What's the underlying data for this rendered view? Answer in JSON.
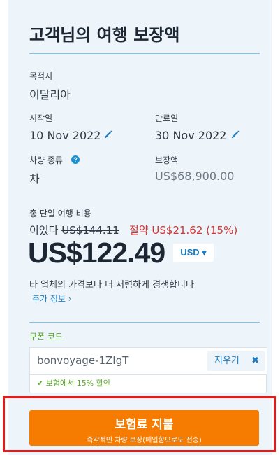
{
  "title": "고객님의 여행 보장액",
  "destination": {
    "label": "목적지",
    "value": "이탈리아"
  },
  "start": {
    "label": "시작일",
    "value": "10 Nov 2022"
  },
  "end": {
    "label": "만료일",
    "value": "30 Nov 2022"
  },
  "vehicle": {
    "label": "차량 종류",
    "value": "차",
    "help": "?"
  },
  "coverage": {
    "label": "보장액",
    "value": "US$68,900.00"
  },
  "pricing": {
    "label": "총 단일 여행 비용",
    "was_prefix": "이었다",
    "old_price": "US$144.11",
    "savings": "절약 US$21.62 (15%)",
    "price": "US$122.49",
    "currency": "USD ▾",
    "compare_text": "타 업체의 가격보다 더 저렴하게 경쟁합니다",
    "more_info": "추가 정보 ›"
  },
  "coupon": {
    "label": "쿠폰 코드",
    "value": "bonvoyage-1ZIgT",
    "clear_label": "지우기",
    "clear_icon": "✖",
    "success_text": "✔ 보험에서 15% 할인"
  },
  "pay_button": {
    "label": "보험료 지불",
    "sublabel": "즉각적인 차량 보장(메일함으로도 전송)"
  },
  "colors": {
    "accent": "#1b7cc4",
    "button": "#f57c00",
    "savings": "#d63434",
    "success": "#5ba82a",
    "highlight": "#e21b1b"
  }
}
